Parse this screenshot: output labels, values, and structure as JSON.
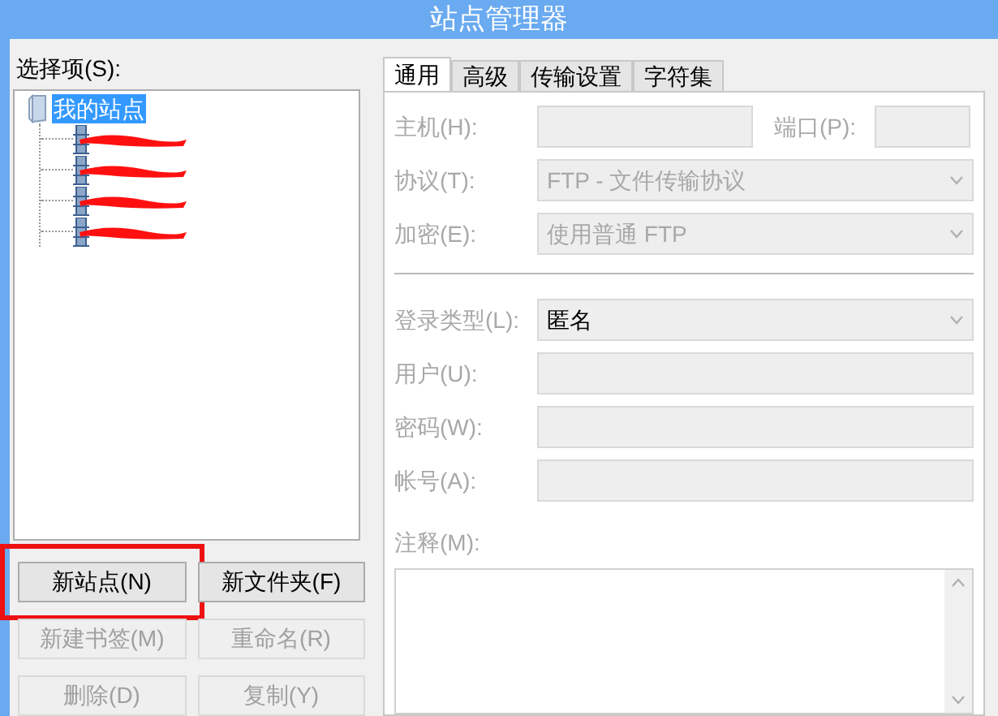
{
  "window": {
    "title": "站点管理器"
  },
  "sidebar": {
    "label": "选择项(S):",
    "tree": {
      "label": "我的站点",
      "selected": true,
      "expanded": true,
      "children": [
        {
          "redacted": true
        },
        {
          "redacted": true
        },
        {
          "redacted": true
        },
        {
          "redacted": true
        }
      ]
    },
    "buttons": [
      {
        "label": "新站点(N)",
        "disabled": false,
        "highlighted": true
      },
      {
        "label": "新文件夹(F)",
        "disabled": false,
        "highlighted": false
      },
      {
        "label": "新建书签(M)",
        "disabled": true,
        "highlighted": false
      },
      {
        "label": "重命名(R)",
        "disabled": true,
        "highlighted": false
      },
      {
        "label": "删除(D)",
        "disabled": true,
        "highlighted": false
      },
      {
        "label": "复制(Y)",
        "disabled": true,
        "highlighted": false
      }
    ]
  },
  "tabs": [
    {
      "label": "通用",
      "selected": true
    },
    {
      "label": "高级",
      "selected": false
    },
    {
      "label": "传输设置",
      "selected": false
    },
    {
      "label": "字符集",
      "selected": false
    }
  ],
  "form": {
    "disabled": true,
    "host": {
      "label": "主机(H):"
    },
    "port": {
      "label": "端口(P):"
    },
    "rows": [
      {
        "kind": "select",
        "label": "协议(T):",
        "value": "FTP - 文件传输协议"
      },
      {
        "kind": "select",
        "label": "加密(E):",
        "value": "使用普通 FTP"
      },
      {
        "kind": "divider"
      },
      {
        "kind": "select",
        "label": "登录类型(L):",
        "value": "匿名",
        "enabled": true
      },
      {
        "kind": "input",
        "label": "用户(U):"
      },
      {
        "kind": "input",
        "label": "密码(W):"
      },
      {
        "kind": "input",
        "label": "帐号(A):"
      }
    ],
    "comment": {
      "label": "注释(M):"
    }
  }
}
